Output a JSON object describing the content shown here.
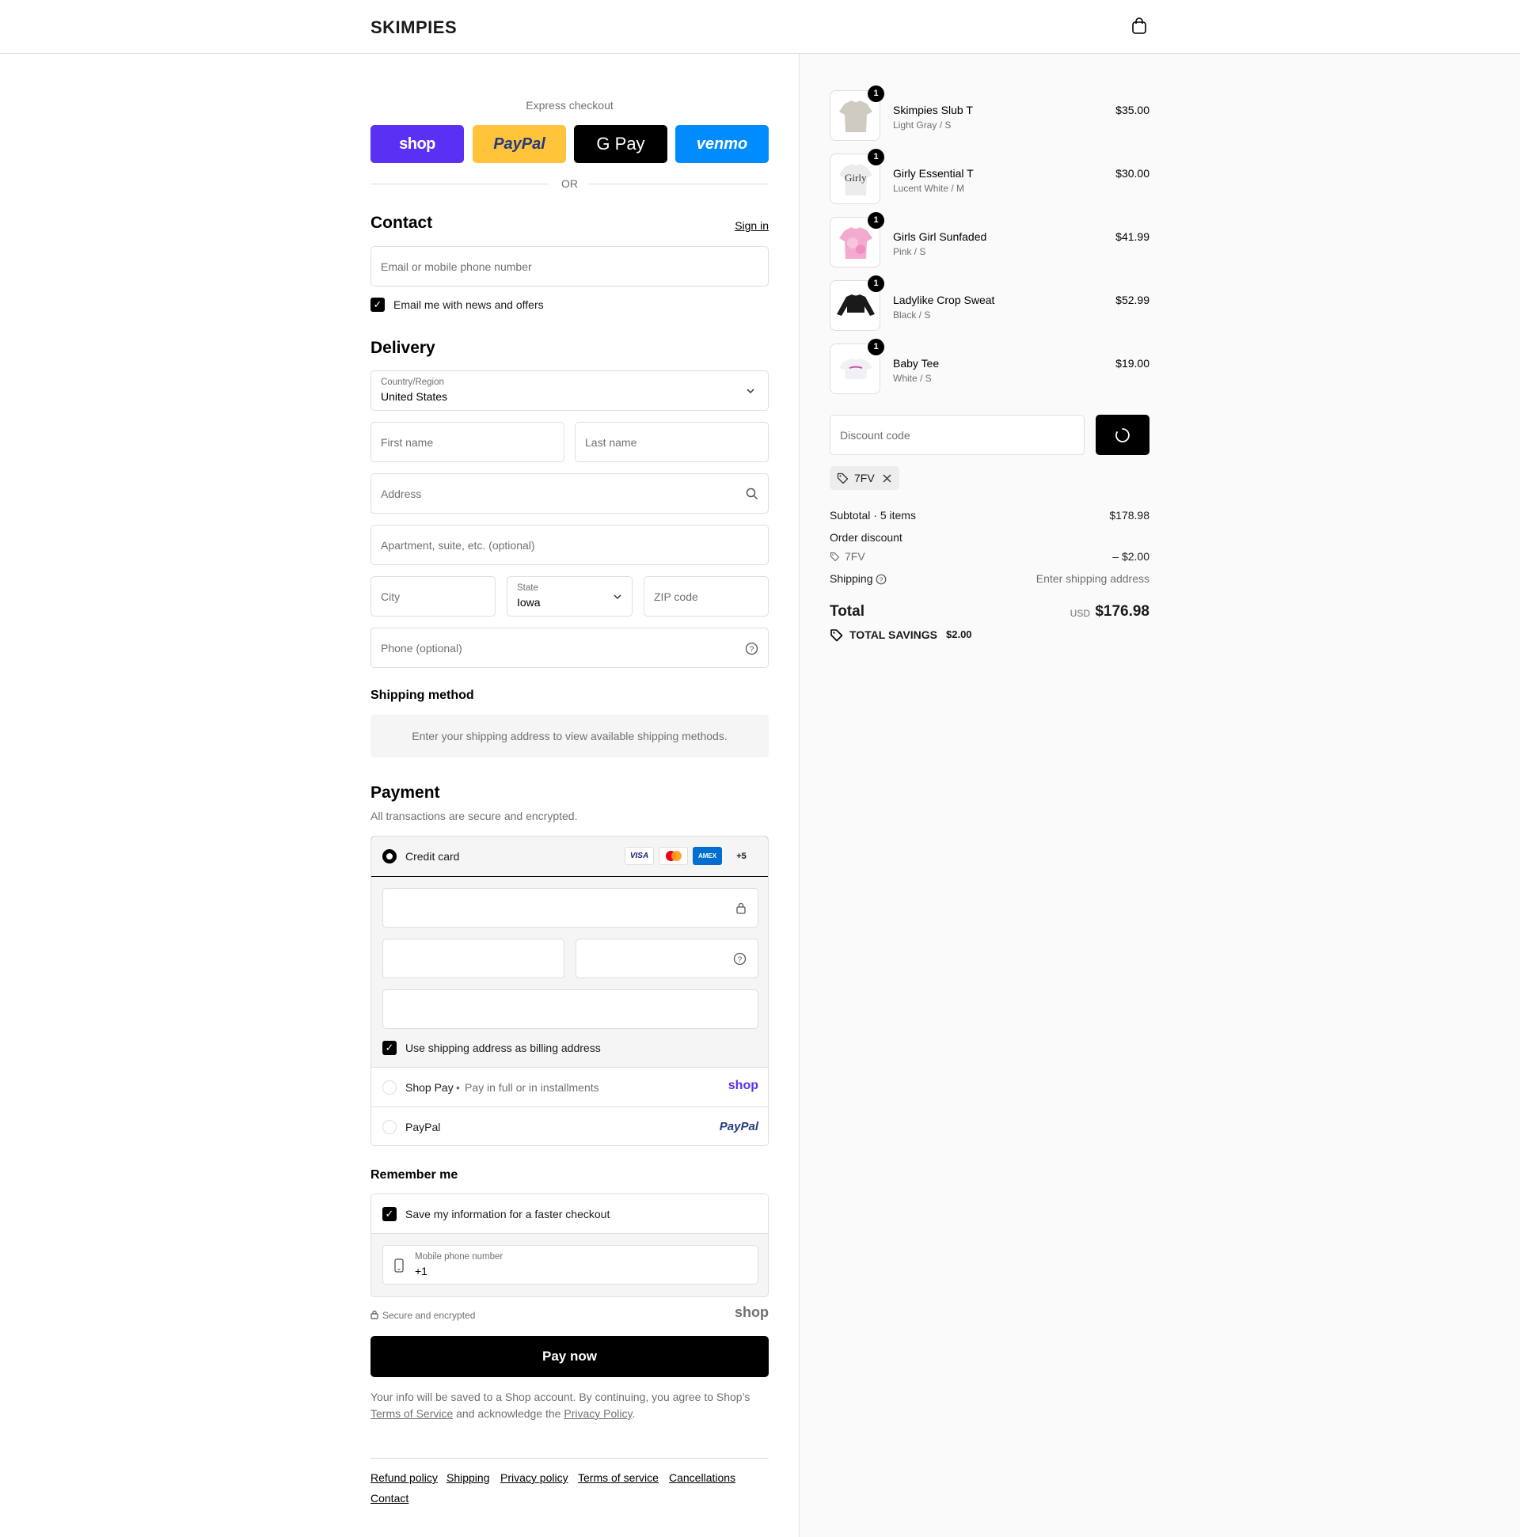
{
  "header": {
    "logo": "SKIMPIES",
    "cart_icon": "shopping-bag-icon"
  },
  "express": {
    "title": "Express checkout",
    "buttons": [
      {
        "label": "shop",
        "bg": "#5a31f4",
        "color": "#ffffff"
      },
      {
        "label": "PayPal",
        "bg": "#ffc439",
        "color": "#253b80"
      },
      {
        "label": "G Pay",
        "bg": "#000000",
        "color": "#ffffff"
      },
      {
        "label": "venmo",
        "bg": "#008cff",
        "color": "#ffffff"
      }
    ],
    "or": "OR"
  },
  "contact": {
    "title": "Contact",
    "sign_in": "Sign in",
    "email_placeholder": "Email or mobile phone number",
    "news_label": "Email me with news and offers",
    "news_checked": true
  },
  "delivery": {
    "title": "Delivery",
    "country_label": "Country/Region",
    "country_value": "United States",
    "first_name": "First name",
    "last_name": "Last name",
    "address": "Address",
    "apartment": "Apartment, suite, etc. (optional)",
    "city": "City",
    "state_label": "State",
    "state_value": "Iowa",
    "zip": "ZIP code",
    "phone": "Phone (optional)"
  },
  "shipping_method": {
    "title": "Shipping method",
    "message": "Enter your shipping address to view available shipping methods."
  },
  "payment": {
    "title": "Payment",
    "subtitle": "All transactions are secure and encrypted.",
    "credit_card": "Credit card",
    "card_brands": [
      "VISA",
      "mastercard",
      "AMEX",
      "+5"
    ],
    "billing_label": "Use shipping address as billing address",
    "shop_pay_label": "Shop Pay",
    "shop_pay_detail": "Pay in full or in installments",
    "shop_pay_logo": "shop",
    "paypal_label": "PayPal",
    "paypal_logo": "PayPal"
  },
  "remember": {
    "title": "Remember me",
    "save_label": "Save my information for a faster checkout",
    "mobile_label": "Mobile phone number",
    "mobile_value": "+1",
    "secure": "Secure and encrypted",
    "shop_logo": "shop"
  },
  "pay_now": "Pay now",
  "legal": {
    "text1": "Your info will be saved to a Shop account. By continuing, you agree to Shop’s",
    "terms": "Terms of Service",
    "text2": "and acknowledge the",
    "privacy": "Privacy Policy",
    "text3": "."
  },
  "footer": [
    "Refund policy",
    "Shipping",
    "Privacy policy",
    "Terms of service",
    "Cancellations",
    "Contact"
  ],
  "cart": {
    "items": [
      {
        "name": "Skimpies Slub T",
        "variant": "Light Gray / S",
        "price": "$35.00",
        "qty": "1",
        "color": "#cfcac2"
      },
      {
        "name": "Girly Essential T",
        "variant": "Lucent White / M",
        "price": "$30.00",
        "qty": "1",
        "color": "#ececec"
      },
      {
        "name": "Girls Girl Sunfaded",
        "variant": "Pink / S",
        "price": "$41.99",
        "qty": "1",
        "color": "#f4a9cf"
      },
      {
        "name": "Ladylike Crop Sweat",
        "variant": "Black / S",
        "price": "$52.99",
        "qty": "1",
        "color": "#1a1a1a"
      },
      {
        "name": "Baby Tee",
        "variant": "White / S",
        "price": "$19.00",
        "qty": "1",
        "color": "#f1f0f4"
      }
    ],
    "thumb_text_girly": "Girly",
    "discount_placeholder": "Discount code",
    "applied_code": "7FV",
    "subtotal_label": "Subtotal · 5 items",
    "subtotal": "$178.98",
    "order_discount": "Order discount",
    "discount_code": "7FV",
    "discount_amount": "– $2.00",
    "shipping_label": "Shipping",
    "shipping_value": "Enter shipping address",
    "total_label": "Total",
    "currency": "USD",
    "total": "$176.98",
    "savings_label": "TOTAL SAVINGS",
    "savings": "$2.00"
  }
}
